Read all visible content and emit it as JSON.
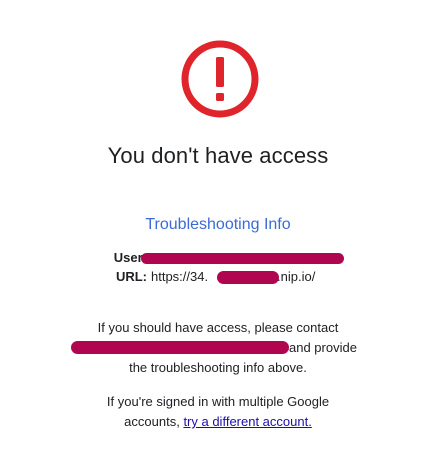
{
  "icon": {
    "name": "alert-circle-icon",
    "color": "#e0242b"
  },
  "headline": "You don't have access",
  "troubleshooting": {
    "heading": "Troubleshooting Info",
    "user_label": "User:",
    "url_label": "URL:",
    "url_prefix": "https://34.",
    "url_suffix": ".nip.io/"
  },
  "contact": {
    "line1": "If you should have access, please contact",
    "line2_suffix": "and provide",
    "line3": "the troubleshooting info above."
  },
  "multi_account": {
    "line1": "If you're signed in with multiple Google",
    "line2_prefix": "accounts,",
    "link_text": "try a different account."
  },
  "colors": {
    "heading_blue": "#3d6ad6",
    "link_blue": "#1a0dab",
    "redaction": "#b0064f",
    "alert_red": "#e0242b"
  }
}
